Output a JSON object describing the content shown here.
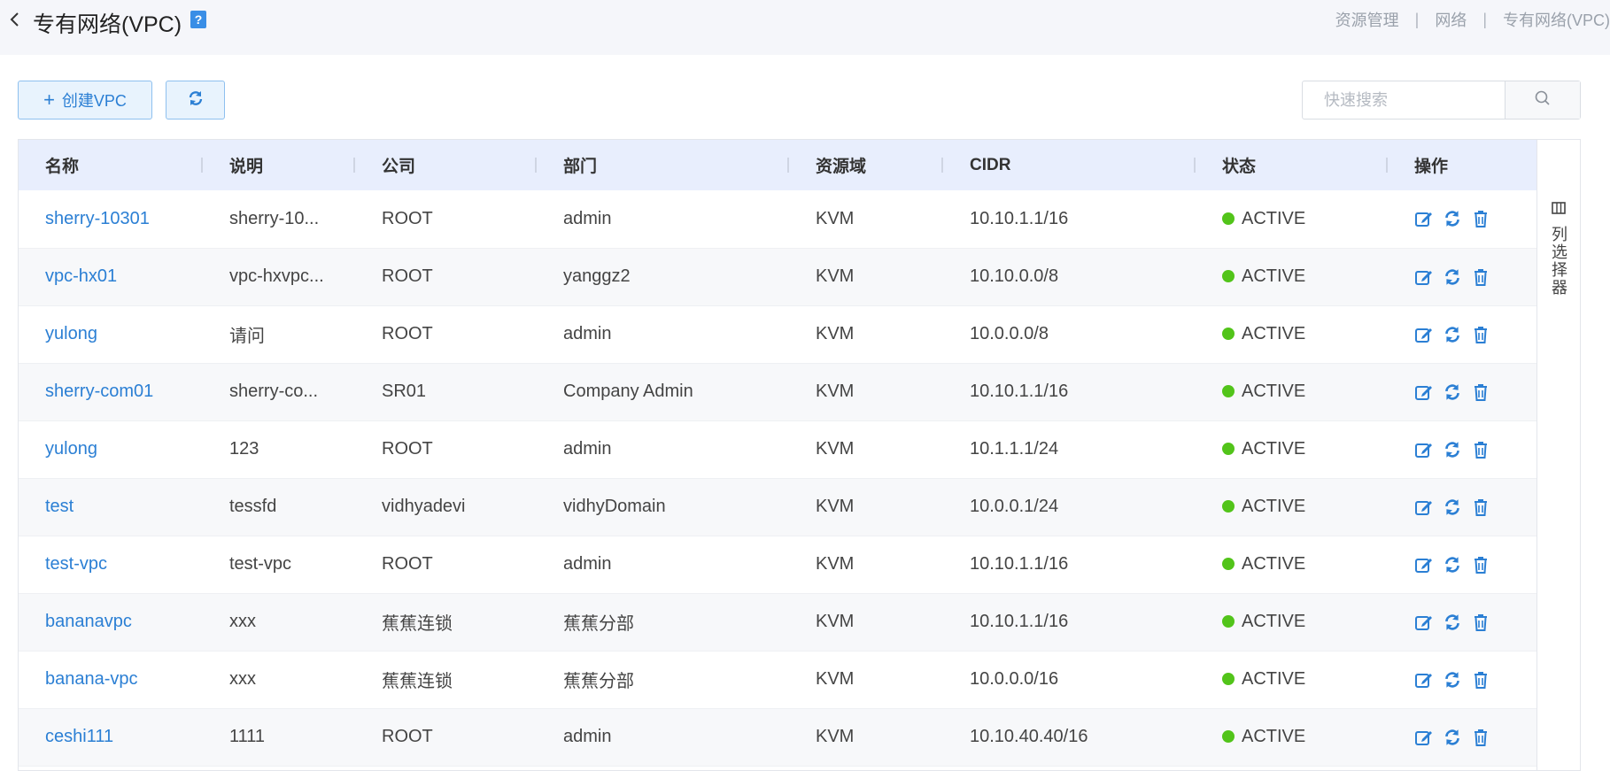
{
  "header": {
    "title": "专有网络(VPC)",
    "help_label": "?",
    "breadcrumb": [
      "资源管理",
      "网络",
      "专有网络(VPC)"
    ]
  },
  "toolbar": {
    "create_label": "创建VPC",
    "search_placeholder": "快速搜索"
  },
  "table": {
    "columns": [
      "名称",
      "说明",
      "公司",
      "部门",
      "资源域",
      "CIDR",
      "状态",
      "操作"
    ],
    "rows": [
      {
        "name": "sherry-10301",
        "desc": "sherry-10...",
        "company": "ROOT",
        "dept": "admin",
        "domain": "KVM",
        "cidr": "10.10.1.1/16",
        "status": "ACTIVE"
      },
      {
        "name": "vpc-hx01",
        "desc": "vpc-hxvpc...",
        "company": "ROOT",
        "dept": "yanggz2",
        "domain": "KVM",
        "cidr": "10.10.0.0/8",
        "status": "ACTIVE"
      },
      {
        "name": "yulong",
        "desc": "请问",
        "company": "ROOT",
        "dept": "admin",
        "domain": "KVM",
        "cidr": "10.0.0.0/8",
        "status": "ACTIVE"
      },
      {
        "name": "sherry-com01",
        "desc": "sherry-co...",
        "company": "SR01",
        "dept": "Company Admin",
        "domain": "KVM",
        "cidr": "10.10.1.1/16",
        "status": "ACTIVE"
      },
      {
        "name": "yulong",
        "desc": "123",
        "company": "ROOT",
        "dept": "admin",
        "domain": "KVM",
        "cidr": "10.1.1.1/24",
        "status": "ACTIVE"
      },
      {
        "name": "test",
        "desc": "tessfd",
        "company": "vidhyadevi",
        "dept": "vidhyDomain",
        "domain": "KVM",
        "cidr": "10.0.0.1/24",
        "status": "ACTIVE"
      },
      {
        "name": "test-vpc",
        "desc": "test-vpc",
        "company": "ROOT",
        "dept": "admin",
        "domain": "KVM",
        "cidr": "10.10.1.1/16",
        "status": "ACTIVE"
      },
      {
        "name": "bananavpc",
        "desc": "xxx",
        "company": "蕉蕉连锁",
        "dept": "蕉蕉分部",
        "domain": "KVM",
        "cidr": "10.10.1.1/16",
        "status": "ACTIVE"
      },
      {
        "name": "banana-vpc",
        "desc": "xxx",
        "company": "蕉蕉连锁",
        "dept": "蕉蕉分部",
        "domain": "KVM",
        "cidr": "10.0.0.0/16",
        "status": "ACTIVE"
      },
      {
        "name": "ceshi111",
        "desc": "1111",
        "company": "ROOT",
        "dept": "admin",
        "domain": "KVM",
        "cidr": "10.10.40.40/16",
        "status": "ACTIVE"
      }
    ]
  },
  "column_selector": {
    "label": "列选择器",
    "icon": "columns-icon"
  },
  "colors": {
    "accent": "#2b7fd4",
    "status_active": "#52c41a",
    "header_bg": "#e8eefd"
  }
}
